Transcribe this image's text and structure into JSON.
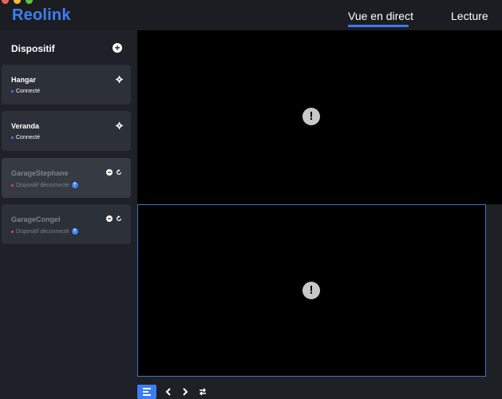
{
  "app": {
    "logo": "Reolink"
  },
  "colors": {
    "accent": "#3b7bf0",
    "online": "#3b82f6",
    "offline": "#e24b4b",
    "selection_border": "#3f73c8"
  },
  "nav": {
    "tabs": [
      {
        "label": "Vue en direct",
        "active": true
      },
      {
        "label": "Lecture",
        "active": false
      }
    ]
  },
  "sidebar": {
    "title": "Dispositif",
    "add_icon": "plus-circle-icon",
    "devices": [
      {
        "name": "Hangar",
        "status": "Connecté",
        "online": true,
        "icons": [
          "gear-icon"
        ]
      },
      {
        "name": "Veranda",
        "status": "Connecté",
        "online": true,
        "icons": [
          "gear-icon"
        ]
      },
      {
        "name": "GarageStephane",
        "status": "Dispositif déconnecté",
        "online": false,
        "selected": true,
        "icons": [
          "minus-circle-icon",
          "refresh-icon",
          "help-icon"
        ]
      },
      {
        "name": "GarageCongel",
        "status": "Dispositif déconnecté",
        "online": false,
        "icons": [
          "minus-circle-icon",
          "refresh-icon",
          "help-icon"
        ]
      }
    ]
  },
  "video": {
    "panes": [
      {
        "state_icon": "exclamation-icon",
        "selected": false
      },
      {
        "state_icon": "exclamation-icon",
        "selected": true
      }
    ],
    "alert_glyph": "!"
  },
  "toolbar": {
    "buttons": [
      "layout-icon",
      "chevron-left-icon",
      "chevron-right-icon",
      "switch-icon"
    ]
  }
}
